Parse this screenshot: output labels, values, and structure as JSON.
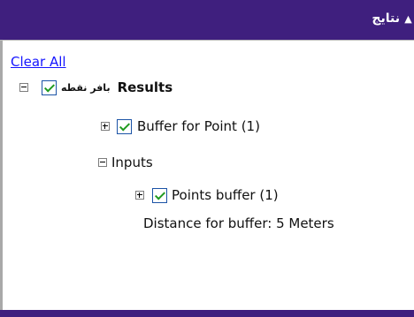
{
  "header": {
    "title": "نتایج",
    "toggle_symbol": "▲"
  },
  "actions": {
    "clear_all": "Clear All"
  },
  "tree": {
    "root": {
      "label_en": "Results",
      "label_fa": "بافر نقطه"
    },
    "items": [
      {
        "label": "Buffer for Point (1)"
      },
      {
        "label": "Inputs"
      },
      {
        "label": "Points buffer (1)"
      }
    ],
    "detail": "Distance for buffer: 5 Meters"
  },
  "colors": {
    "header_background": "#3f1f7e",
    "link": "#1515ff",
    "check": "#1f9a1f"
  },
  "icons": {
    "collapse": "minus-box-icon",
    "expand": "plus-box-icon",
    "checked": "checkbox-checked-icon",
    "toggle": "triangle-up-icon"
  }
}
